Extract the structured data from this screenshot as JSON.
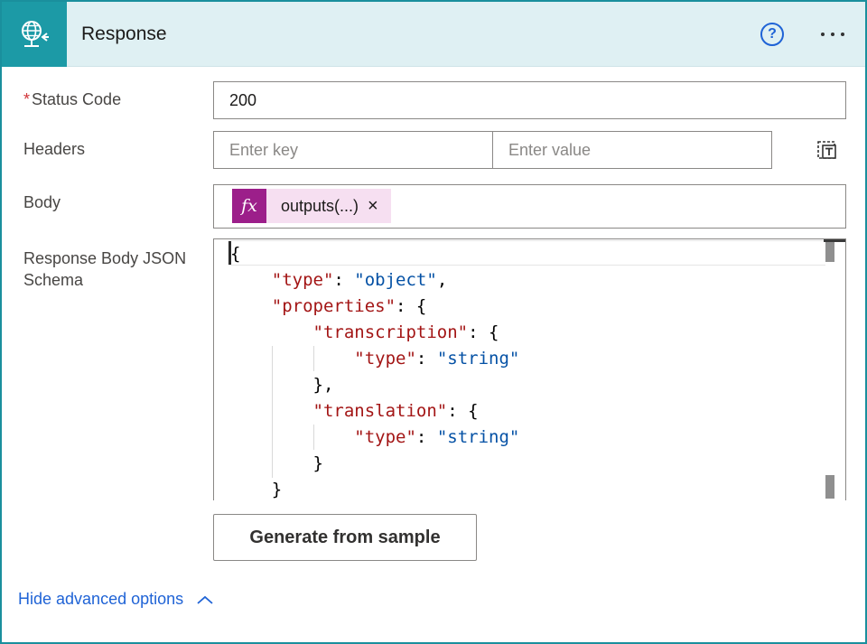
{
  "header": {
    "title": "Response",
    "icon": "globe-response-icon",
    "help_icon": "question-circle-icon",
    "more_icon": "more-options-icon",
    "help_glyph": "?"
  },
  "fields": {
    "status_code": {
      "label": "Status Code",
      "required_mark": "*",
      "value": "200"
    },
    "headers": {
      "label": "Headers",
      "key_placeholder": "Enter key",
      "value_placeholder": "Enter value"
    },
    "body": {
      "label": "Body",
      "token": {
        "fx": "fx",
        "text": "outputs(...)",
        "remove": "×"
      }
    },
    "schema": {
      "label_line1": "Response Body JSON",
      "label_line2": "Schema",
      "lines": [
        {
          "indent": 0,
          "parts": [
            [
              "p",
              "{"
            ]
          ]
        },
        {
          "indent": 1,
          "parts": [
            [
              "k",
              "\"type\""
            ],
            [
              "p",
              ": "
            ],
            [
              "s",
              "\"object\""
            ],
            [
              "p",
              ","
            ]
          ]
        },
        {
          "indent": 1,
          "parts": [
            [
              "k",
              "\"properties\""
            ],
            [
              "p",
              ": {"
            ]
          ]
        },
        {
          "indent": 2,
          "parts": [
            [
              "k",
              "\"transcription\""
            ],
            [
              "p",
              ": {"
            ]
          ]
        },
        {
          "indent": 3,
          "parts": [
            [
              "k",
              "\"type\""
            ],
            [
              "p",
              ": "
            ],
            [
              "s",
              "\"string\""
            ]
          ]
        },
        {
          "indent": 2,
          "parts": [
            [
              "p",
              "},"
            ]
          ]
        },
        {
          "indent": 2,
          "parts": [
            [
              "k",
              "\"translation\""
            ],
            [
              "p",
              ": {"
            ]
          ]
        },
        {
          "indent": 3,
          "parts": [
            [
              "k",
              "\"type\""
            ],
            [
              "p",
              ": "
            ],
            [
              "s",
              "\"string\""
            ]
          ]
        },
        {
          "indent": 2,
          "parts": [
            [
              "p",
              "}"
            ]
          ]
        },
        {
          "indent": 1,
          "parts": [
            [
              "p",
              "}"
            ]
          ]
        }
      ]
    }
  },
  "actions": {
    "generate_label": "Generate from sample",
    "advanced_label": "Hide advanced options"
  },
  "colors": {
    "header_bg": "#dff0f3",
    "icon_bg": "#1c9aa6",
    "token_bg": "#f6dff1",
    "fx_bg": "#9c1f8a",
    "link": "#1f63d6",
    "json_key": "#a31515",
    "json_string": "#0451a5"
  }
}
